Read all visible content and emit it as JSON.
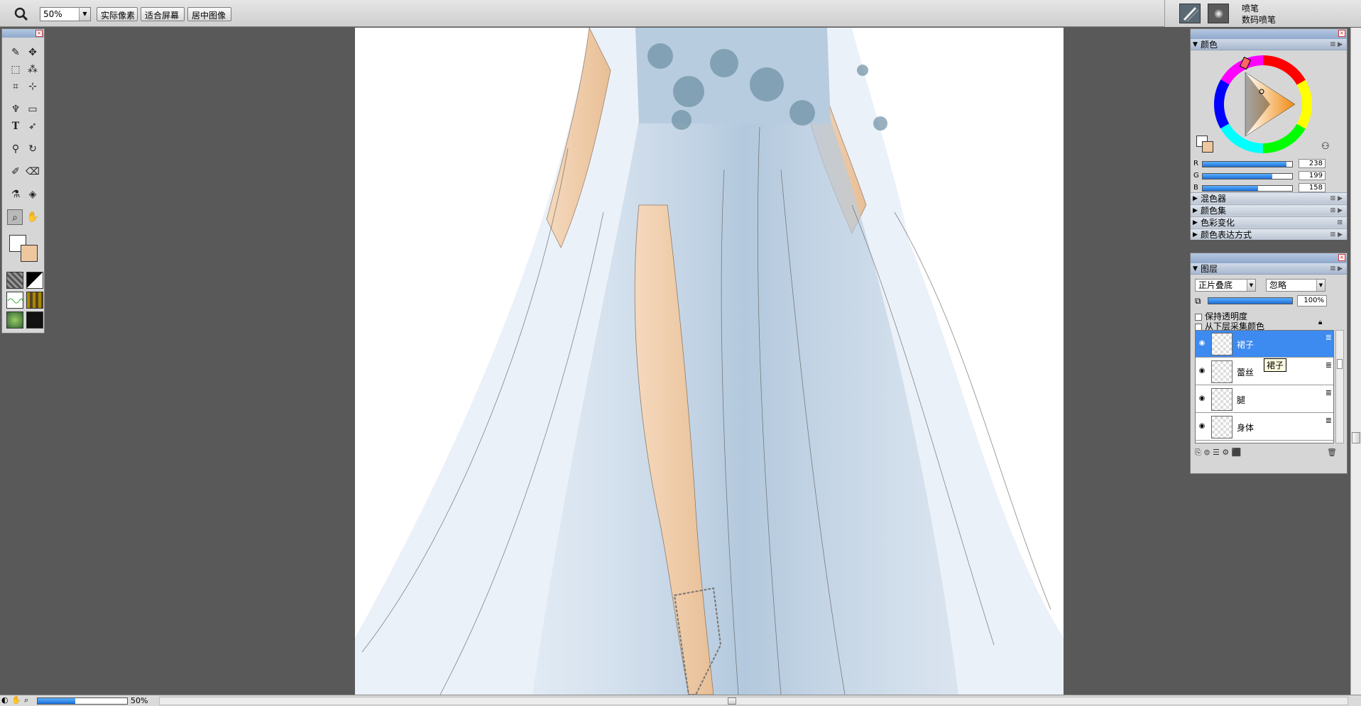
{
  "toolbar": {
    "zoom_value": "50%",
    "actual_pixels": "实际像素",
    "fit_screen": "适合屏幕",
    "center_image": "居中图像",
    "brush_category": "喷笔",
    "brush_variant": "数码喷笔"
  },
  "color_panel": {
    "title": "颜色",
    "rgb": [
      {
        "label": "R",
        "value": "238",
        "fraction": 0.933
      },
      {
        "label": "G",
        "value": "199",
        "fraction": 0.78
      },
      {
        "label": "B",
        "value": "158",
        "fraction": 0.62
      }
    ],
    "sections": [
      "混色器",
      "颜色集",
      "色彩变化",
      "颜色表达方式"
    ],
    "main_color": "#eec79e"
  },
  "layers_panel": {
    "title": "图层",
    "composite_method": "正片叠底",
    "composite_depth": "忽略",
    "opacity": "100%",
    "opacity_fraction": 1.0,
    "preserve_transparency": "保持透明度",
    "pick_up_underlying": "从下层采集颜色",
    "layers": [
      {
        "name": "裙子",
        "selected": true
      },
      {
        "name": "蕾丝",
        "selected": false
      },
      {
        "name": "腿",
        "selected": false
      },
      {
        "name": "身体",
        "selected": false
      }
    ],
    "tooltip": "裙子"
  },
  "status": {
    "zoom": "50%",
    "zoom_fraction": 0.42
  },
  "colors": {
    "accent": "#3d8af0",
    "panel_bg": "#d6d6d6",
    "workspace": "#595959",
    "dress": "#a9c1d8",
    "skin": "#eec79e"
  }
}
